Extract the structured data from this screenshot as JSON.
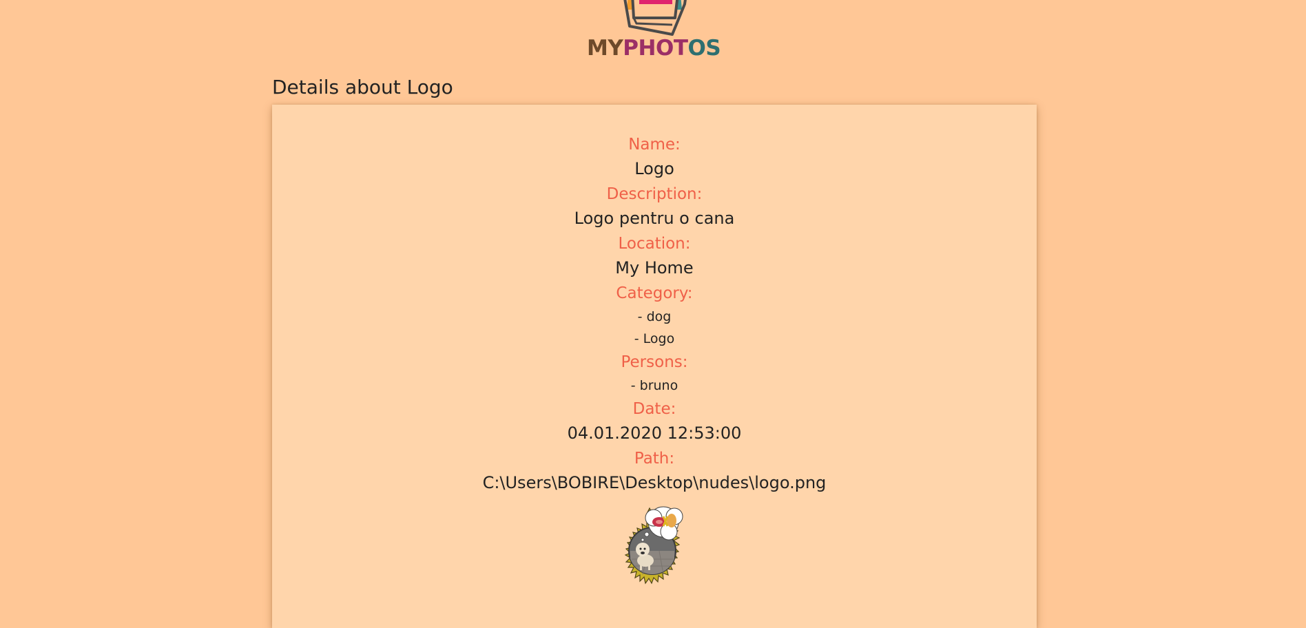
{
  "header": {
    "logo_alt": "MyPhotos logo",
    "logo_part1": "MY",
    "logo_part2": "PHOT",
    "logo_part3": "OS",
    "colors": {
      "part1": "#6e4a2a",
      "part2": "#9b2f66",
      "part3": "#2e6f70"
    }
  },
  "page": {
    "title": "Details about Logo"
  },
  "details": {
    "name_label": "Name:",
    "name_value": "Logo",
    "description_label": "Description:",
    "description_value": "Logo pentru o cana",
    "location_label": "Location:",
    "location_value": "My Home",
    "category_label": "Category:",
    "categories": [
      "- dog",
      "- Logo"
    ],
    "persons_label": "Persons:",
    "persons": [
      "- bruno"
    ],
    "date_label": "Date:",
    "date_value": "04.01.2020 12:53:00",
    "path_label": "Path:",
    "path_value": "C:\\Users\\BOBIRE\\Desktop\\nudes\\logo.png"
  },
  "image": {
    "alt": "dog-photo"
  },
  "theme": {
    "background": "#ffc796",
    "card": "#ffd5ab",
    "label_color": "#ef6048",
    "text_color": "#222222"
  }
}
